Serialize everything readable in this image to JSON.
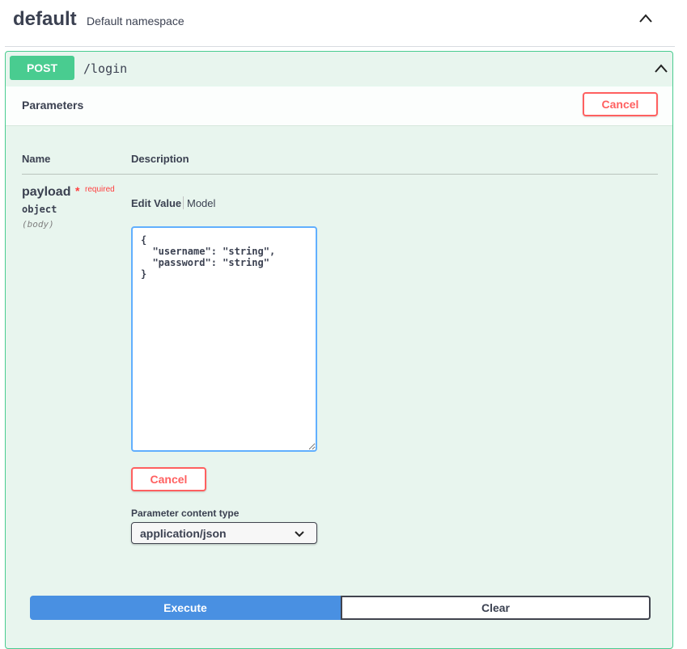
{
  "tag": {
    "name": "default",
    "description": "Default namespace",
    "toggle_icon": "chevron-up-icon"
  },
  "operation": {
    "method": "POST",
    "path": "/login",
    "method_color": "#49cc90",
    "toggle_icon": "chevron-up-icon"
  },
  "parameters": {
    "title": "Parameters",
    "cancel_label": "Cancel",
    "columns": {
      "name": "Name",
      "description": "Description"
    },
    "param": {
      "name": "payload",
      "required_star": "*",
      "required_label": "required",
      "type": "object",
      "location": "(body)"
    },
    "tabs": {
      "edit_value": "Edit Value",
      "model": "Model"
    },
    "body_value": "{\n  \"username\": \"string\",\n  \"password\": \"string\"\n}",
    "inner_cancel_label": "Cancel",
    "content_type_label": "Parameter content type",
    "content_type_value": "application/json"
  },
  "actions": {
    "execute_label": "Execute",
    "clear_label": "Clear",
    "execute_color": "#4990e2"
  },
  "colors": {
    "cancel": "#ff6060",
    "accent_border": "#61affe"
  }
}
